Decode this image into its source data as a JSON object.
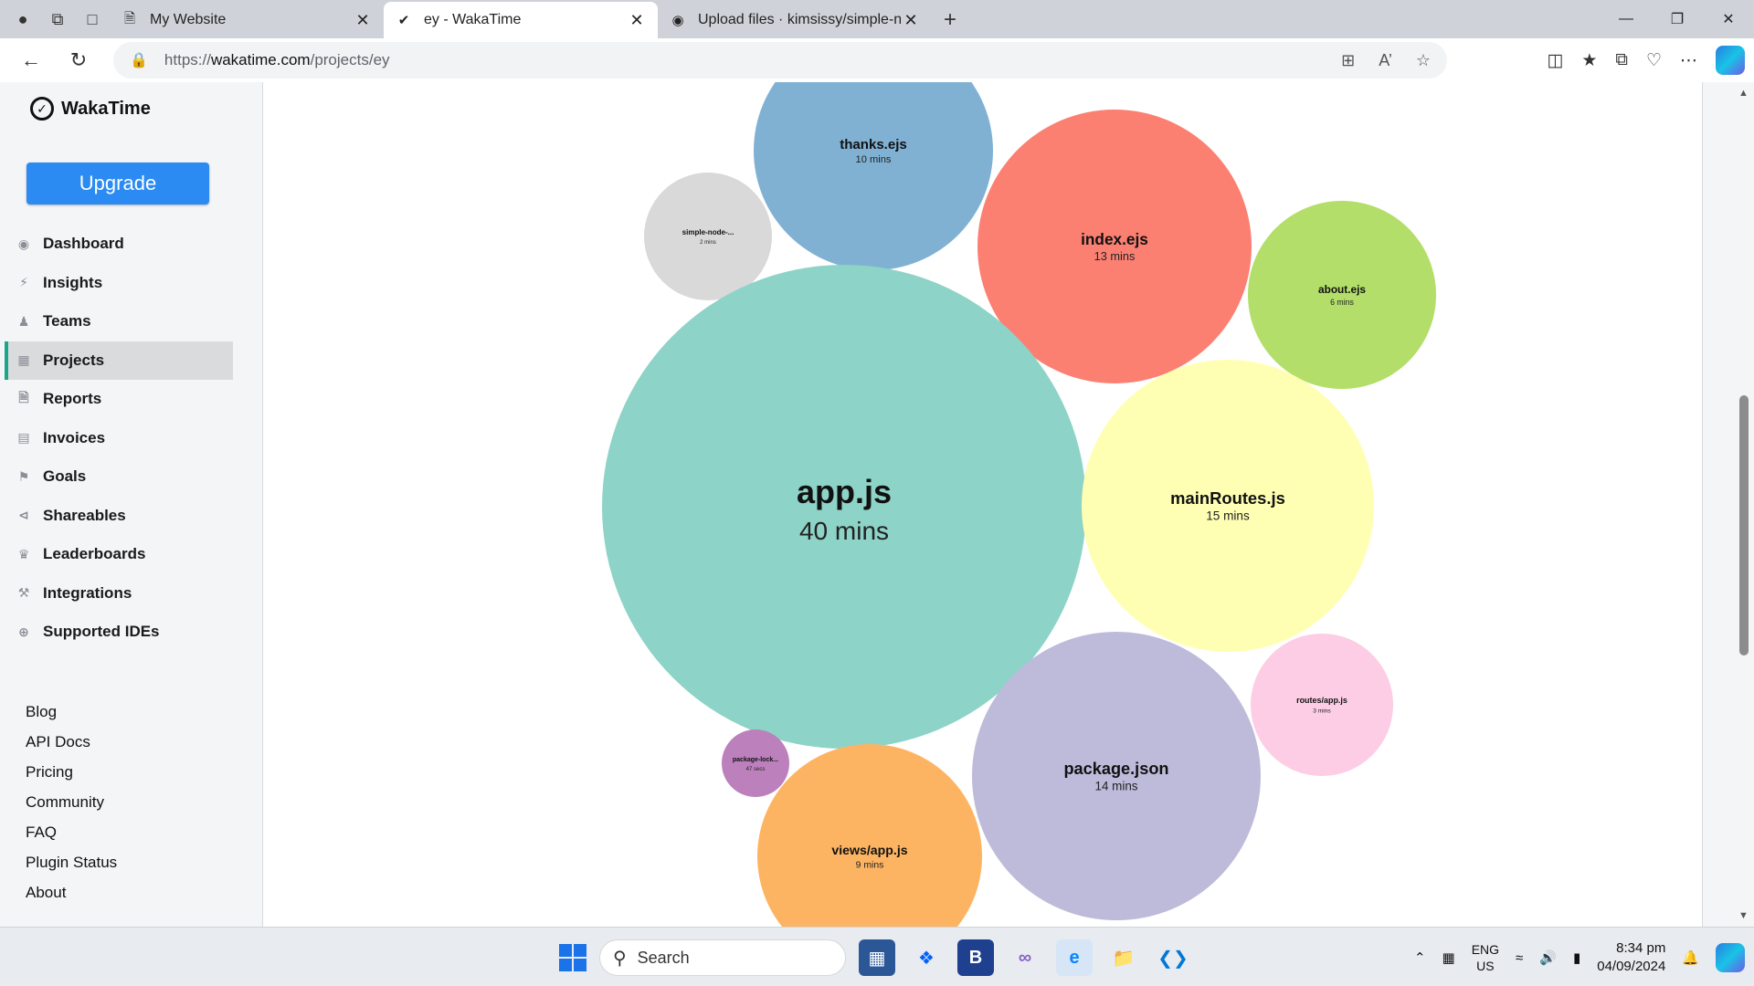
{
  "browser": {
    "tabs": [
      {
        "title": "My Website",
        "icon": "page-icon",
        "active": false
      },
      {
        "title": "ey - WakaTime",
        "icon": "wakatime-icon",
        "active": true
      },
      {
        "title": "Upload files · kimsissy/simple-noc",
        "icon": "github-icon",
        "active": false
      }
    ],
    "url_prefix": "https://",
    "url_host": "wakatime.com",
    "url_path": "/projects/ey"
  },
  "sidebar": {
    "logo_text": "WakaTime",
    "upgrade_label": "Upgrade",
    "menu": [
      {
        "label": "Dashboard",
        "icon": "dashboard-icon"
      },
      {
        "label": "Insights",
        "icon": "bolt-icon"
      },
      {
        "label": "Teams",
        "icon": "users-icon"
      },
      {
        "label": "Projects",
        "icon": "grid-icon",
        "active": true
      },
      {
        "label": "Reports",
        "icon": "report-icon"
      },
      {
        "label": "Invoices",
        "icon": "invoice-icon"
      },
      {
        "label": "Goals",
        "icon": "flag-icon"
      },
      {
        "label": "Shareables",
        "icon": "share-icon"
      },
      {
        "label": "Leaderboards",
        "icon": "trophy-icon"
      },
      {
        "label": "Integrations",
        "icon": "wrench-icon"
      },
      {
        "label": "Supported IDEs",
        "icon": "plus-circle-icon"
      }
    ],
    "footer_links": [
      "Blog",
      "API Docs",
      "Pricing",
      "Community",
      "FAQ",
      "Plugin Status",
      "About"
    ]
  },
  "bubbles": [
    {
      "name": "thanks.ejs",
      "time": "10 mins",
      "minutes": 10,
      "color": "#80b1d3"
    },
    {
      "name": "simple-node-...",
      "time": "2 mins",
      "minutes": 2,
      "color": "#d9d9d9"
    },
    {
      "name": "index.ejs",
      "time": "13 mins",
      "minutes": 13,
      "color": "#fb8072"
    },
    {
      "name": "about.ejs",
      "time": "6 mins",
      "minutes": 6,
      "color": "#b3de69"
    },
    {
      "name": "app.js",
      "time": "40 mins",
      "minutes": 40,
      "color": "#8dd3c7"
    },
    {
      "name": "mainRoutes.js",
      "time": "15 mins",
      "minutes": 15,
      "color": "#ffffb3"
    },
    {
      "name": "routes/app.js",
      "time": "3 mins",
      "minutes": 3,
      "color": "#fccde5"
    },
    {
      "name": "package-lock...",
      "time": "47 secs",
      "minutes": 0.8,
      "color": "#bc80bd"
    },
    {
      "name": "package.json",
      "time": "14 mins",
      "minutes": 14,
      "color": "#bebada"
    },
    {
      "name": "views/app.js",
      "time": "9 mins",
      "minutes": 9,
      "color": "#fdb462"
    }
  ],
  "taskbar": {
    "search_placeholder": "Search",
    "lang_top": "ENG",
    "lang_bottom": "US",
    "time": "8:34 pm",
    "date": "04/09/2024"
  }
}
